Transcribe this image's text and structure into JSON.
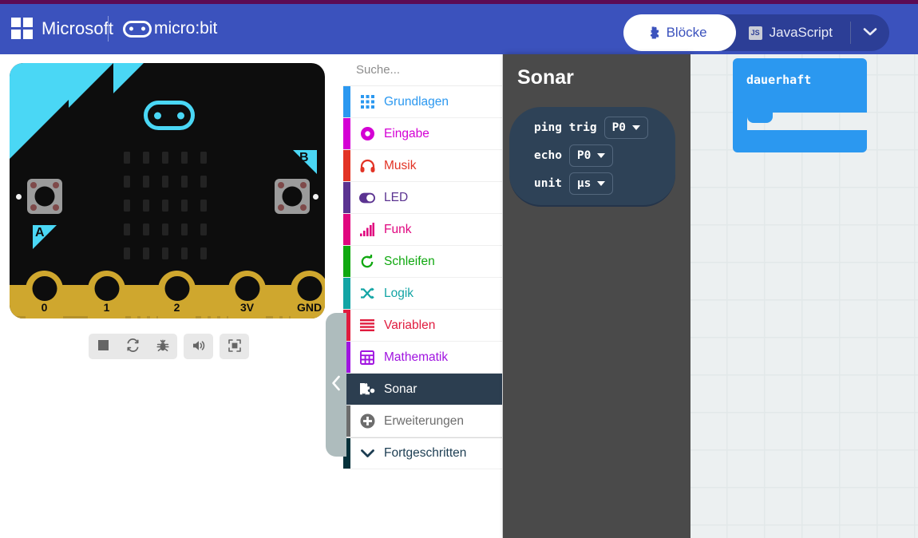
{
  "header": {
    "brand_microsoft": "Microsoft",
    "brand_microbit": "micro:bit",
    "toggle": {
      "blocks_label": "Blöcke",
      "javascript_label": "JavaScript",
      "js_badge": "JS",
      "blocks_icon": "puzzle-piece-icon",
      "menu_icon": "chevron-down-icon"
    },
    "colors": {
      "header_bg": "#3b52bd",
      "accent_bar": "#5c0b54",
      "active_text": "#3b52bd"
    }
  },
  "simulator": {
    "board": {
      "buttons": [
        {
          "label": "A"
        },
        {
          "label": "B"
        }
      ],
      "pins": [
        {
          "label": "0"
        },
        {
          "label": "1"
        },
        {
          "label": "2"
        },
        {
          "label": "3V"
        },
        {
          "label": "GND"
        }
      ],
      "led_grid": {
        "rows": 5,
        "cols": 5
      },
      "colors": {
        "body": "#0d0d0d",
        "accent": "#4ad7f5",
        "connector": "#cfa72e"
      }
    },
    "controls": [
      {
        "name": "stop-button",
        "icon": "stop-square-icon"
      },
      {
        "name": "restart-button",
        "icon": "refresh-icon"
      },
      {
        "name": "debug-button",
        "icon": "bug-icon"
      },
      {
        "name": "sound-button",
        "icon": "speaker-icon"
      },
      {
        "name": "fullscreen-button",
        "icon": "fullscreen-icon"
      }
    ]
  },
  "toolbox": {
    "search": {
      "placeholder": "Suche...",
      "value": "",
      "icon": "search-icon"
    },
    "categories": [
      {
        "label": "Grundlagen",
        "stripe": "#2b98f0",
        "text": "#2b98f0",
        "icon": "grid-icon",
        "selected": false
      },
      {
        "label": "Eingabe",
        "stripe": "#d400d4",
        "text": "#d400d4",
        "icon": "circle-dot-icon",
        "selected": false
      },
      {
        "label": "Musik",
        "stripe": "#e23325",
        "text": "#e23325",
        "icon": "headphones-icon",
        "selected": false
      },
      {
        "label": "LED",
        "stripe": "#5b3391",
        "text": "#5b3391",
        "icon": "toggle-icon",
        "selected": false
      },
      {
        "label": "Funk",
        "stripe": "#e0067f",
        "text": "#e0067f",
        "icon": "signal-bars-icon",
        "selected": false
      },
      {
        "label": "Schleifen",
        "stripe": "#10a810",
        "text": "#10a810",
        "icon": "loop-arrow-icon",
        "selected": false
      },
      {
        "label": "Logik",
        "stripe": "#13a5a5",
        "text": "#13a5a5",
        "icon": "shuffle-icon",
        "selected": false
      },
      {
        "label": "Variablen",
        "stripe": "#e01b3e",
        "text": "#e01b3e",
        "icon": "lines-icon",
        "selected": false
      },
      {
        "label": "Mathematik",
        "stripe": "#a014e0",
        "text": "#a014e0",
        "icon": "calculator-icon",
        "selected": false
      },
      {
        "label": "Sonar",
        "stripe": "#2c3e50",
        "text": "#ffffff",
        "icon": "puzzle-icon",
        "selected": true
      },
      {
        "label": "Erweiterungen",
        "stripe": "#6d6d6d",
        "text": "#6d6d6d",
        "icon": "plus-circle-icon",
        "selected": false
      },
      {
        "label": "Fortgeschritten",
        "stripe": "#05313a",
        "text": "#1c3d52",
        "icon": "chevron-down-icon",
        "selected": false
      }
    ]
  },
  "flyout": {
    "title": "Sonar",
    "block": {
      "name": "ping-block",
      "color": "#2e4257",
      "rows": [
        {
          "label": "ping trig",
          "field_value": "P0"
        },
        {
          "label": "echo",
          "field_value": "P0"
        },
        {
          "label": "unit",
          "field_value": "µs"
        }
      ]
    }
  },
  "collapse_handle": {
    "icon": "chevron-left-icon"
  },
  "workspace": {
    "blocks": [
      {
        "name": "forever-block",
        "label": "dauerhaft",
        "color": "#2b98f0"
      }
    ]
  }
}
